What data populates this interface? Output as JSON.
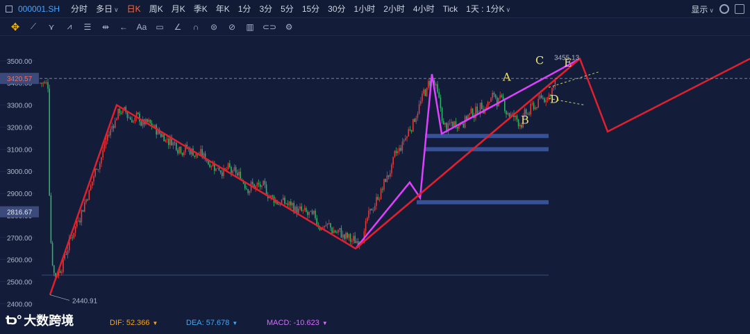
{
  "toolbar": {
    "symbol": "000001.SH",
    "timeframes": [
      {
        "label": "分时",
        "active": false
      },
      {
        "label": "多日",
        "active": false,
        "dropdown": true
      },
      {
        "label": "日K",
        "active": true
      },
      {
        "label": "周K",
        "active": false
      },
      {
        "label": "月K",
        "active": false
      },
      {
        "label": "季K",
        "active": false
      },
      {
        "label": "年K",
        "active": false
      },
      {
        "label": "1分",
        "active": false
      },
      {
        "label": "3分",
        "active": false
      },
      {
        "label": "5分",
        "active": false
      },
      {
        "label": "15分",
        "active": false
      },
      {
        "label": "30分",
        "active": false
      },
      {
        "label": "1小时",
        "active": false
      },
      {
        "label": "2小时",
        "active": false
      },
      {
        "label": "4小时",
        "active": false
      },
      {
        "label": "Tick",
        "active": false
      },
      {
        "label": "1天 : 1分K",
        "active": false,
        "dropdown": true
      }
    ],
    "display_label": "显示",
    "active_color": "#ff6a3d"
  },
  "drawing_tools": [
    {
      "name": "crosshair-move-icon",
      "glyph": "✥"
    },
    {
      "name": "line-tool-icon",
      "glyph": "⟋"
    },
    {
      "name": "fib-tool-icon",
      "glyph": "⋎"
    },
    {
      "name": "wave-tool-icon",
      "glyph": "⩘"
    },
    {
      "name": "channel-tool-icon",
      "glyph": "☰"
    },
    {
      "name": "measure-tool-icon",
      "glyph": "⇹"
    },
    {
      "name": "arrow-tool-icon",
      "glyph": "←"
    },
    {
      "name": "text-tool-icon",
      "glyph": "Aa"
    },
    {
      "name": "note-tool-icon",
      "glyph": "▭"
    },
    {
      "name": "brush-tool-icon",
      "glyph": "∠"
    },
    {
      "name": "magnet-tool-icon",
      "glyph": "∩"
    },
    {
      "name": "lock-tool-icon",
      "glyph": "⊜"
    },
    {
      "name": "hide-tool-icon",
      "glyph": "⊘"
    },
    {
      "name": "delete-tool-icon",
      "glyph": "▥"
    },
    {
      "name": "link-tool-icon",
      "glyph": "⊂⊃"
    },
    {
      "name": "settings-tool-icon",
      "glyph": "⚙"
    }
  ],
  "chart_data": {
    "type": "candlestick-with-annotations",
    "ylim": [
      2370,
      3600
    ],
    "y_ticks": [
      2400,
      2500,
      2600,
      2700,
      2800,
      2900,
      3000,
      3100,
      3200,
      3300,
      3400,
      3500
    ],
    "y_tick_labels": [
      "2400.00",
      "2500.00",
      "2600.00",
      "2700.00",
      "2800.00",
      "2900.00",
      "3000.00",
      "3100.00",
      "3200.00",
      "3300.00",
      "3400.00",
      "3500.00"
    ],
    "current_price": 3420.57,
    "current_price_label": "3420.57",
    "cursor_price_label": "2816.67",
    "cursor_price": 2816.67,
    "low_label": "2440.91",
    "high_label": "3455.13",
    "colors": {
      "up": "#e23b3b",
      "down": "#2fb36a",
      "zigzag": "#e0202e",
      "wave": "#e040ff",
      "label": "#f0e06a",
      "zone": "#3d5aa6"
    },
    "wave_labels": [
      "A",
      "B",
      "C",
      "D",
      "E"
    ],
    "zigzag_prices": [
      2440.91,
      3300,
      2650,
      3510,
      3180,
      3510
    ],
    "wave_prices": [
      2650,
      2950,
      2880,
      3440,
      3170,
      3510
    ],
    "zones": [
      3160,
      3100,
      2860
    ],
    "series_seed": 7
  },
  "macd": {
    "dif_label": "DIF: 52.366",
    "dea_label": "DEA: 57.678",
    "macd_label": "MACD: -10.623",
    "dif_color": "#f5a623",
    "dea_color": "#3fa9f5",
    "macd_color": "#d86bff"
  },
  "logo": {
    "text": "大数跨境"
  }
}
